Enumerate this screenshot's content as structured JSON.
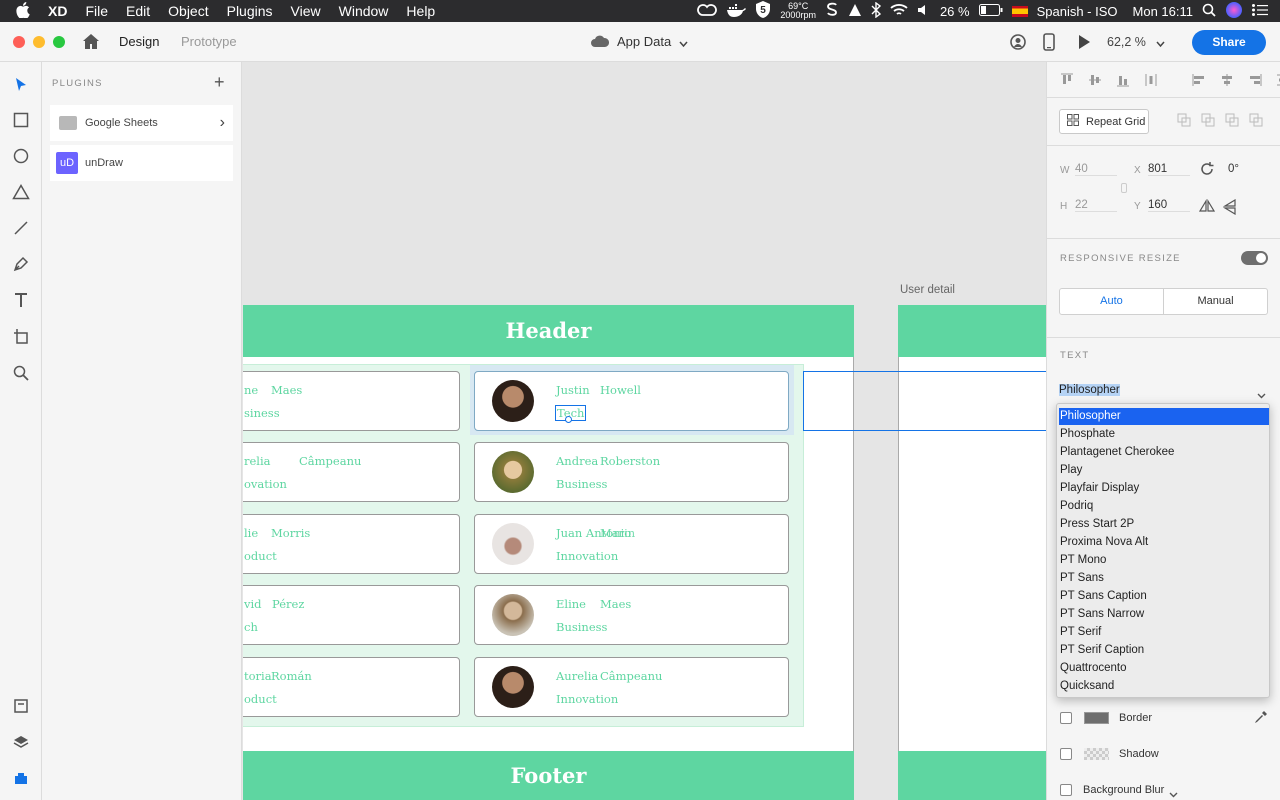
{
  "menubar": {
    "app": "XD",
    "items": [
      "File",
      "Edit",
      "Object",
      "Plugins",
      "View",
      "Window",
      "Help"
    ],
    "temp": "69°C",
    "rpm": "2000rpm",
    "battery": "26 %",
    "input_source": "Spanish - ISO",
    "clock": "Mon 16:11"
  },
  "titlebar": {
    "tab_design": "Design",
    "tab_prototype": "Prototype",
    "doc_title": "App Data",
    "zoom": "62,2 %",
    "share": "Share"
  },
  "plugins": {
    "title": "PLUGINS",
    "add": "+",
    "items": [
      {
        "label": "Google Sheets",
        "chevron": "›"
      },
      {
        "label": "unDraw",
        "badge": "uD"
      }
    ]
  },
  "canvas": {
    "artboard_label": "User detail",
    "header": "Header",
    "footer": "Footer",
    "left_cards": [
      {
        "first": "ne",
        "last": "Maes",
        "dept": "siness"
      },
      {
        "first": "relia",
        "last": "Câmpeanu",
        "dept": "ovation"
      },
      {
        "first": "lie",
        "last": "Morris",
        "dept": "oduct"
      },
      {
        "first": "vid",
        "last": "Pérez",
        "dept": "ch"
      },
      {
        "first": "toria",
        "last": "Román",
        "dept": "oduct"
      }
    ],
    "right_cards": [
      {
        "first": "Justin",
        "last": "Howell",
        "dept": "Tech"
      },
      {
        "first": "Andrea",
        "last": "Roberston",
        "dept": "Business"
      },
      {
        "first": "Juan Antonio",
        "last": "Marin",
        "dept": "Innovation"
      },
      {
        "first": "Eline",
        "last": "Maes",
        "dept": "Business"
      },
      {
        "first": "Aurelia",
        "last": "Câmpeanu",
        "dept": "Innovation"
      }
    ]
  },
  "inspector": {
    "repeat_grid": "Repeat Grid",
    "w_label": "W",
    "w": "40",
    "h_label": "H",
    "h": "22",
    "x_label": "X",
    "x": "801",
    "y_label": "Y",
    "y": "160",
    "rotation": "0°",
    "responsive_resize": "RESPONSIVE RESIZE",
    "auto": "Auto",
    "manual": "Manual",
    "text_section": "TEXT",
    "font_value": "Philosopher",
    "font_options": [
      "Philosopher",
      "Phosphate",
      "Plantagenet Cherokee",
      "Play",
      "Playfair Display",
      "Podriq",
      "Press Start 2P",
      "Proxima Nova Alt",
      "PT Mono",
      "PT Sans",
      "PT Sans Caption",
      "PT Sans Narrow",
      "PT Serif",
      "PT Serif Caption",
      "Quattrocento",
      "Quicksand"
    ],
    "selected_font_index": 0,
    "border": "Border",
    "shadow": "Shadow",
    "background_blur": "Background Blur"
  },
  "colors": {
    "accent": "#1473e6",
    "mint": "#5ed6a1",
    "selection": "#1a63f0"
  }
}
